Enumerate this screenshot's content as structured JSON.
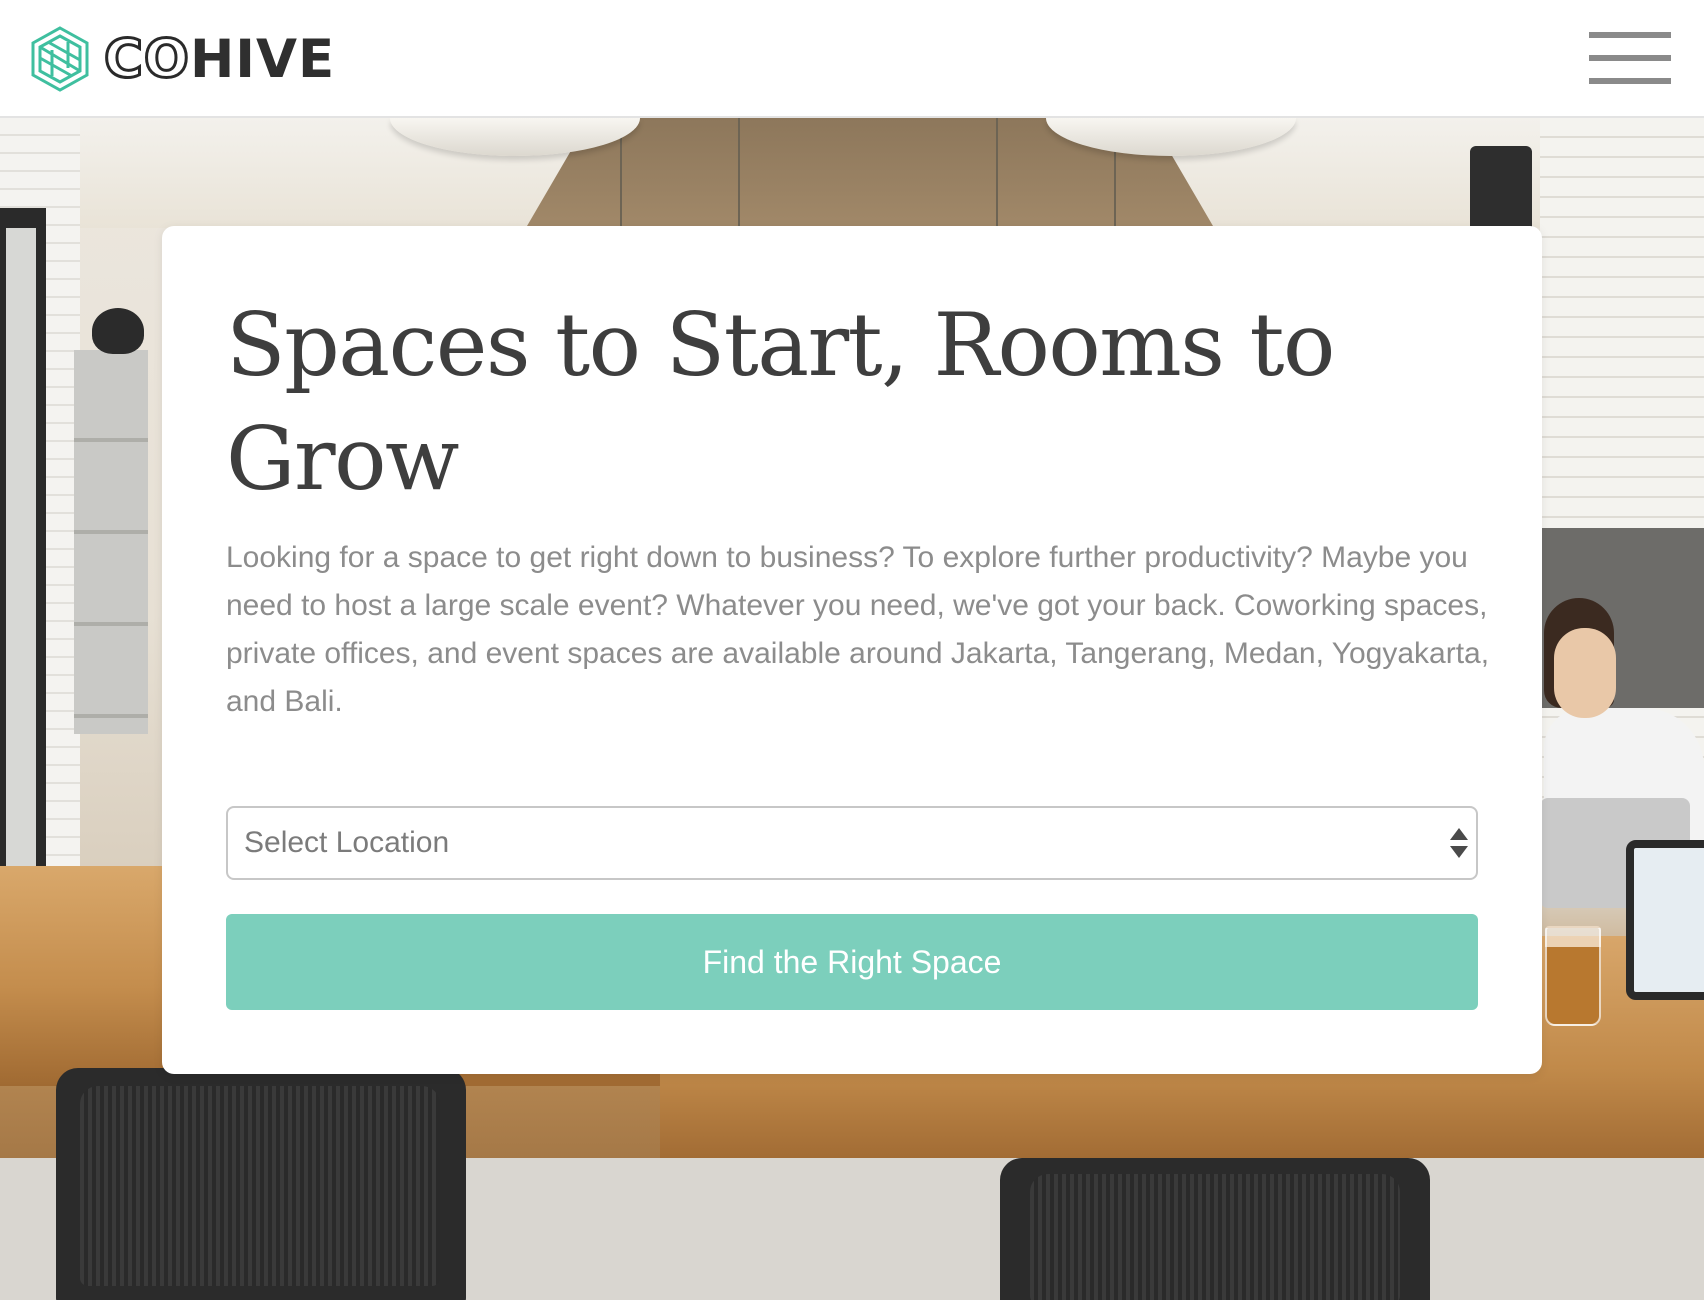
{
  "header": {
    "logo": {
      "co": "CO",
      "hive": "HIVE",
      "mark_icon": "cohive-logo-icon"
    },
    "menu_icon": "hamburger-menu-icon"
  },
  "hero": {
    "background": "coworking office photo"
  },
  "search_card": {
    "title": "Spaces to Start, Rooms to Grow",
    "description": "Looking for a space to get right down to business? To explore further productivity? Maybe you need to host a large scale event? Whatever you need, we've got your back. Coworking spaces, private offices, and event spaces are available around Jakarta, Tangerang, Medan, Yogyakarta, and Bali.",
    "location_select": {
      "selected": "Select Location",
      "arrows_icon": "select-arrows-icon"
    },
    "button_label": "Find the Right Space"
  },
  "colors": {
    "accent": "#7ccfbc",
    "logo_teal": "#3fbf9f",
    "title_text": "#3e3e3e",
    "body_text": "#8c8c8c"
  }
}
